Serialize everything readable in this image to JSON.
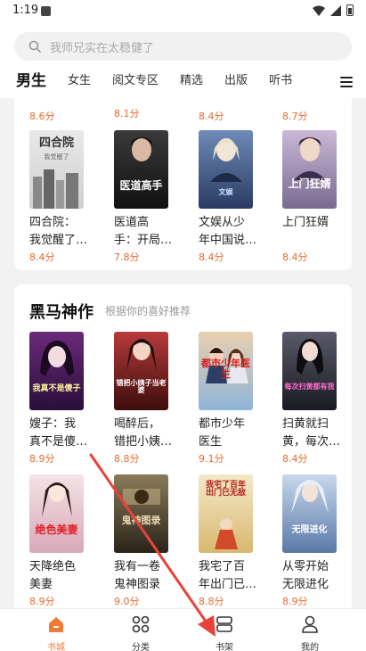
{
  "status_bar": {
    "time": "1:19"
  },
  "search": {
    "placeholder": "我师兄实在太稳健了"
  },
  "tabs": [
    {
      "label": "男生",
      "active": true
    },
    {
      "label": "女生"
    },
    {
      "label": "阅文专区"
    },
    {
      "label": "精选"
    },
    {
      "label": "出版"
    },
    {
      "label": "听书"
    }
  ],
  "top_row_scores": [
    "8.6分",
    "8.1分",
    "8.4分",
    "8.7分"
  ],
  "top_books": [
    {
      "title_line1": "四合院：",
      "title_line2": "我觉醒了…",
      "score": "8.4分",
      "cover_text": "四合院",
      "cover_sub": "我觉醒了"
    },
    {
      "title_line1": "医道高",
      "title_line2": "手：开局…",
      "score": "7.8分",
      "cover_text": "医道高手"
    },
    {
      "title_line1": "文娱从少",
      "title_line2": "年中国说…",
      "score": "8.4分",
      "cover_text": "文娱"
    },
    {
      "title_line1": "上门狂婿",
      "title_line2": "",
      "score": "8.4分",
      "cover_text": "上门狂婿"
    }
  ],
  "section": {
    "title": "黑马神作",
    "subtitle": "根据你的喜好推荐"
  },
  "dark_books_row1": [
    {
      "title_line1": "嫂子：我",
      "title_line2": "真不是傻…",
      "score": "8.9分",
      "cover_text": "我真不是傻子"
    },
    {
      "title_line1": "喝醉后，",
      "title_line2": "错把小姨…",
      "score": "8.8分",
      "cover_text": "错把小姨子当老婆"
    },
    {
      "title_line1": "都市少年",
      "title_line2": "医生",
      "score": "9.1分",
      "cover_text": "都市少年医生"
    },
    {
      "title_line1": "扫黄就扫",
      "title_line2": "黄，每次…",
      "score": "8.4分",
      "cover_text": "每次扫黄都有我"
    }
  ],
  "dark_books_row2": [
    {
      "title_line1": "天降绝色",
      "title_line2": "美妻",
      "score": "8.9分",
      "cover_text": "绝色美妻"
    },
    {
      "title_line1": "我有一卷",
      "title_line2": "鬼神图录",
      "score": "9.0分",
      "cover_text": "鬼神图录"
    },
    {
      "title_line1": "我宅了百",
      "title_line2": "年出门已…",
      "score": "8.8分",
      "cover_text": "我宅了百年出门已无敌"
    },
    {
      "title_line1": "从零开始",
      "title_line2": "无限进化",
      "score": "8.9分",
      "cover_text": "无限进化"
    }
  ],
  "bottom_nav": [
    {
      "label": "书城",
      "icon": "home-icon",
      "active": true
    },
    {
      "label": "分类",
      "icon": "grid-icon"
    },
    {
      "label": "书架",
      "icon": "bookshelf-icon"
    },
    {
      "label": "我的",
      "icon": "user-icon"
    }
  ],
  "colors": {
    "accent": "#f07a36",
    "score": "#e86a2c",
    "arrow": "#e8423a"
  }
}
